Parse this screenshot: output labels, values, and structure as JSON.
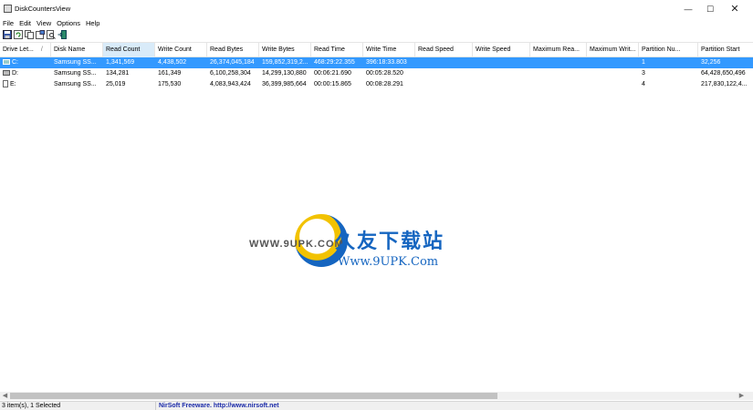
{
  "window": {
    "title": "DiskCountersView",
    "minimize_glyph": "—",
    "maximize_glyph": "☐",
    "close_glyph": "✕"
  },
  "menu": [
    "File",
    "Edit",
    "View",
    "Options",
    "Help"
  ],
  "toolbar": {
    "icons": [
      "save-icon",
      "refresh-icon",
      "copy-icon",
      "properties-icon",
      "find-icon",
      "exit-icon"
    ]
  },
  "table": {
    "sort_indicator": "/",
    "columns": [
      "Drive Let...",
      "Disk Name",
      "Read Count",
      "Write Count",
      "Read Bytes",
      "Write Bytes",
      "Read Time",
      "Write Time",
      "Read Speed",
      "Write Speed",
      "Maximum Rea...",
      "Maximum Writ...",
      "Partition Nu...",
      "Partition Start"
    ],
    "rows": [
      [
        "C:",
        "Samsung SS...",
        "1,341,569",
        "4,438,502",
        "26,374,045,184",
        "159,852,319,2...",
        "468:29:22.355",
        "396:18:33.803",
        "",
        "",
        "",
        "",
        "1",
        "32,256"
      ],
      [
        "D:",
        "Samsung SS...",
        "134,281",
        "161,349",
        "6,100,258,304",
        "14,299,130,880",
        "00:06:21.690",
        "00:05:28.520",
        "",
        "",
        "",
        "",
        "3",
        "64,428,650,496"
      ],
      [
        "E:",
        "Samsung SS...",
        "25,019",
        "175,530",
        "4,083,943,424",
        "36,399,985,664",
        "00:00:15.865",
        "00:08:28.291",
        "",
        "",
        "",
        "",
        "4",
        "217,830,122,4..."
      ]
    ],
    "selected_row": 0
  },
  "watermark": {
    "url_left": "WWW.9UPK.COM",
    "brand_cn": "久友下载站",
    "url": "Www.9UPK.Com"
  },
  "status": {
    "selection": "3 item(s), 1 Selected",
    "link": "NirSoft Freeware.  http://www.nirsoft.net"
  },
  "colors": {
    "selection": "#3399ff",
    "link": "#1a2aa8"
  }
}
